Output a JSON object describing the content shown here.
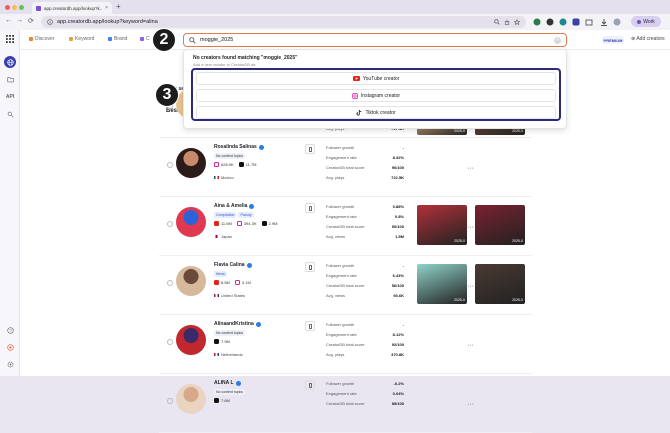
{
  "browser": {
    "tab_title": "app.creatordb.app/lookup?k...",
    "tab_close": "×",
    "new_tab": "+",
    "url": "app.creatordb.app/lookup?keyword=alina",
    "profile_label": "Work",
    "nav_back": "←",
    "nav_forward": "→",
    "nav_reload": "⟳"
  },
  "sidebar": {
    "api_label": "API"
  },
  "topnav": {
    "items": [
      {
        "label": "Discover",
        "color": "#e48a2a"
      },
      {
        "label": "Keyword",
        "color": "#e0a23a"
      },
      {
        "label": "Brand",
        "color": "#3b82f6"
      },
      {
        "label": "C",
        "color": "#8b5cf6"
      }
    ],
    "premium": "PREMIUM",
    "add_creators": "Add creators"
  },
  "search": {
    "value": "moggie_2025",
    "clear": "×"
  },
  "dropdown": {
    "title": "No creators found matching \"moggie_2025\"",
    "subtitle": "Add a new creator to CreatorDB as:",
    "options": [
      {
        "label": "YouTube creator",
        "icon": "youtube-icon"
      },
      {
        "label": "Instagram creator",
        "icon": "instagram-icon"
      },
      {
        "label": "Tiktok creator",
        "icon": "tiktok-icon"
      }
    ]
  },
  "annotations": {
    "step2": "2",
    "step3": "3"
  },
  "lookup_label": "Lookup se",
  "best_label": "Best m",
  "creators": [
    {
      "name": "",
      "tags": [],
      "socials": [],
      "country": "Mexico",
      "flag_colors": [
        "#006847",
        "#ffffff",
        "#ce1126"
      ],
      "metrics": [
        {
          "label": "Avg. plays",
          "value": "717.4K"
        }
      ],
      "thumbs": [
        "#c9a37a",
        "#6b4b3a"
      ],
      "thumb_dates": [
        "2025-0",
        "2025-0"
      ],
      "avatar": [
        "#e8c38f",
        "#a0724a"
      ],
      "partial": true
    },
    {
      "name": "Rosalinda Salinas",
      "tags": [
        {
          "label": "No content topics",
          "style": ""
        }
      ],
      "socials": [
        {
          "type": "ig",
          "value": "628.9K"
        },
        {
          "type": "tt",
          "value": "11.7M"
        }
      ],
      "country": "Mexico",
      "flag_colors": [
        "#006847",
        "#ffffff",
        "#ce1126"
      ],
      "metrics": [
        {
          "label": "Follower growth",
          "value": "-"
        },
        {
          "label": "Engagement rate",
          "value": "8.32%"
        },
        {
          "label": "CreatorDB total score",
          "value": "96/100"
        },
        {
          "label": "Avg. plays",
          "value": "722.5K"
        }
      ],
      "thumbs": [],
      "thumb_dates": [],
      "avatar": [
        "#2b1c1a",
        "#c98a6a"
      ]
    },
    {
      "name": "Aina & Amelia",
      "tags": [
        {
          "label": "Compilation",
          "style": "blue"
        },
        {
          "label": "Parody",
          "style": "blue"
        }
      ],
      "socials": [
        {
          "type": "yt",
          "value": "11.5M"
        },
        {
          "type": "ig",
          "value": "394.3K"
        },
        {
          "type": "tt",
          "value": "2.9M"
        }
      ],
      "country": "Japan",
      "flag_colors": [
        "#ffffff",
        "#bc002d",
        "#ffffff"
      ],
      "metrics": [
        {
          "label": "Follower growth",
          "value": "0.88%"
        },
        {
          "label": "Engagement rate",
          "value": "0.8%"
        },
        {
          "label": "CreatorDB total score",
          "value": "90/100"
        },
        {
          "label": "Avg. views",
          "value": "1.5M"
        }
      ],
      "thumbs": [
        "#b1313a",
        "#7a2230"
      ],
      "thumb_dates": [
        "2025-0",
        "2025-0"
      ],
      "avatar": [
        "#e0394f",
        "#2c63d8"
      ]
    },
    {
      "name": "Flavia Calina",
      "tags": [
        {
          "label": "News",
          "style": "blue"
        }
      ],
      "socials": [
        {
          "type": "yt",
          "value": "8.5M"
        },
        {
          "type": "ig",
          "value": "3.1M"
        }
      ],
      "country": "United States",
      "flag_colors": [
        "#b22234",
        "#ffffff",
        "#3c3b6e"
      ],
      "metrics": [
        {
          "label": "Follower growth",
          "value": "-"
        },
        {
          "label": "Engagement rate",
          "value": "6.43%"
        },
        {
          "label": "CreatorDB total score",
          "value": "56/100"
        },
        {
          "label": "Avg. views",
          "value": "93.6K"
        }
      ],
      "thumbs": [
        "#8fd3c9",
        "#4a3a33"
      ],
      "thumb_dates": [
        "2025-0",
        "2025-0"
      ],
      "avatar": [
        "#d6b89a",
        "#6a4a3a"
      ]
    },
    {
      "name": "AlinaandKristina",
      "tags": [
        {
          "label": "No content topics",
          "style": ""
        }
      ],
      "socials": [
        {
          "type": "tt",
          "value": "7.9M"
        }
      ],
      "country": "Netherlands",
      "flag_colors": [
        "#ae1c28",
        "#ffffff",
        "#21468b"
      ],
      "metrics": [
        {
          "label": "Follower growth",
          "value": "-"
        },
        {
          "label": "Engagement rate",
          "value": "8.12%"
        },
        {
          "label": "CreatorDB total score",
          "value": "92/100"
        },
        {
          "label": "Avg. plays",
          "value": "370.8K"
        }
      ],
      "thumbs": [],
      "thumb_dates": [],
      "avatar": [
        "#c0282e",
        "#3a2a6a"
      ]
    },
    {
      "name": "ALINA L",
      "tags": [
        {
          "label": "No content topics",
          "style": ""
        }
      ],
      "socials": [
        {
          "type": "tt",
          "value": "7.6M"
        }
      ],
      "country": "",
      "flag_colors": [],
      "metrics": [
        {
          "label": "Follower growth",
          "value": "-0.2%"
        },
        {
          "label": "Engagement rate",
          "value": "0.04%"
        },
        {
          "label": "CreatorDB total score",
          "value": "89/100"
        }
      ],
      "thumbs": [],
      "thumb_dates": [],
      "avatar": [
        "#e8d4c0",
        "#d7a88a"
      ]
    }
  ]
}
